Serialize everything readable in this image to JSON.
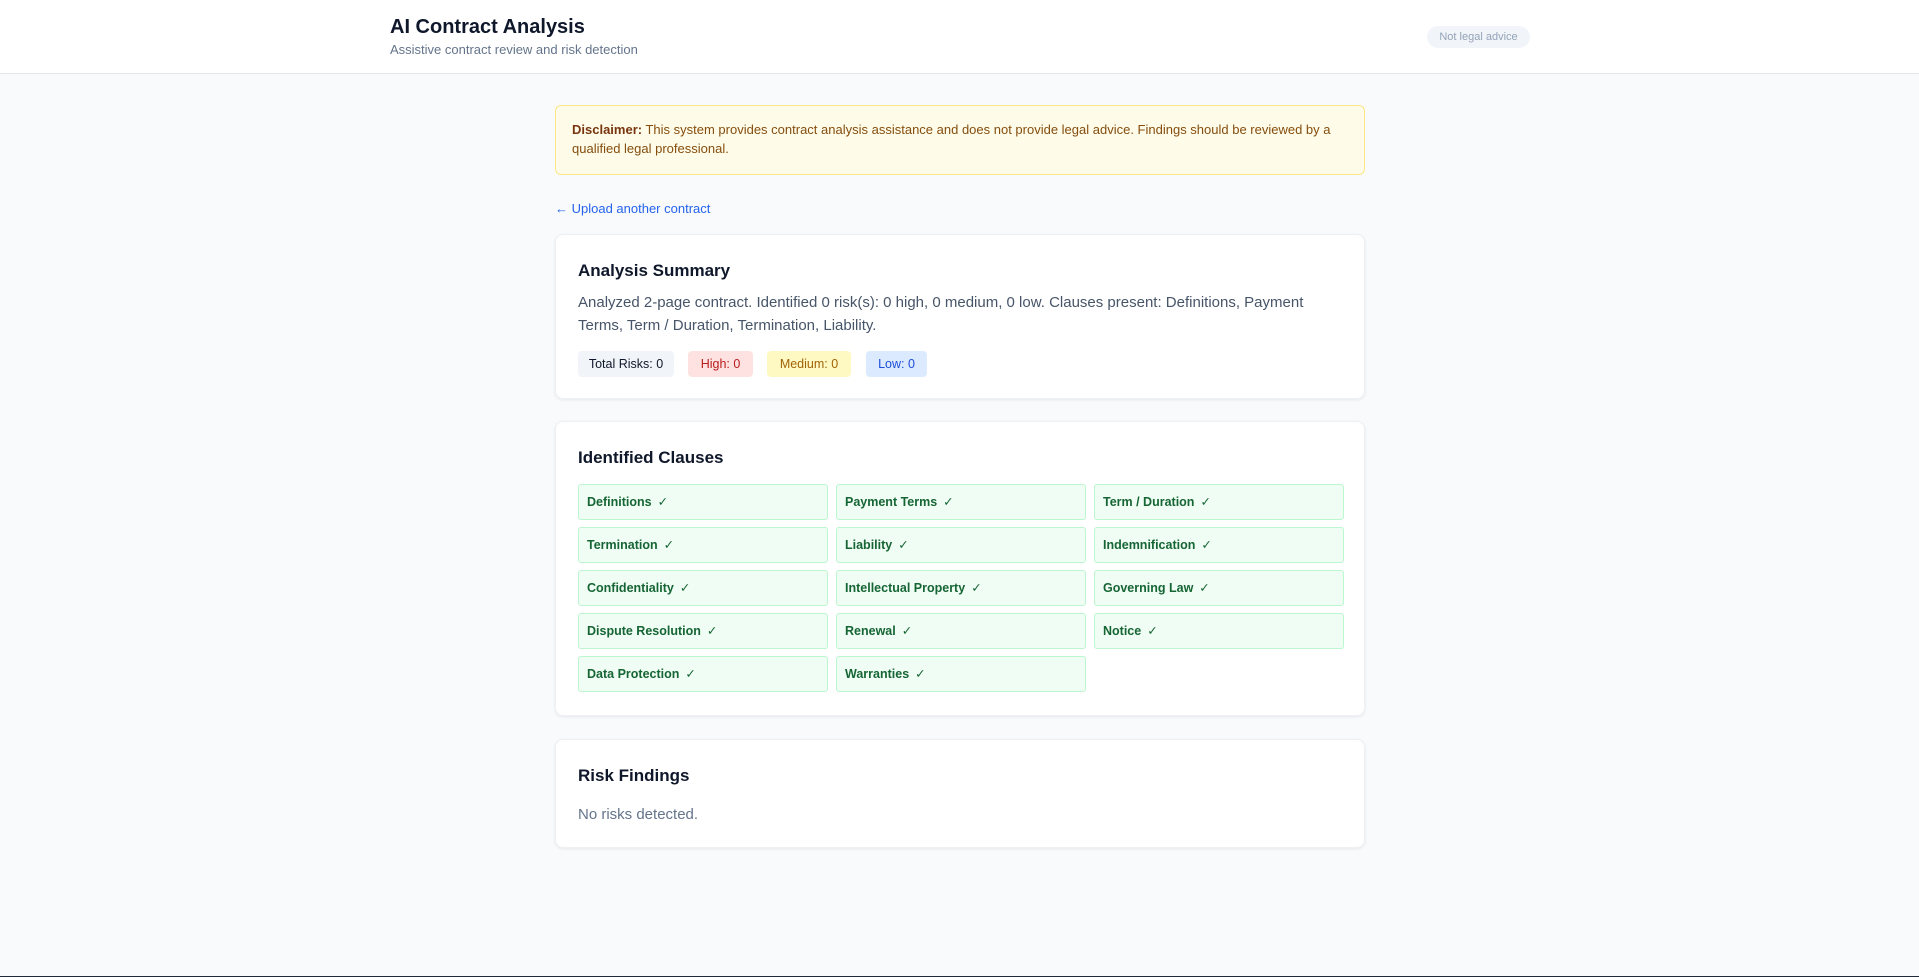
{
  "header": {
    "title": "AI Contract Analysis",
    "subtitle": "Assistive contract review and risk detection",
    "badge": "Not legal advice"
  },
  "disclaimer": {
    "label": "Disclaimer:",
    "text": " This system provides contract analysis assistance and does not provide legal advice. Findings should be reviewed by a qualified legal professional."
  },
  "back_link": "← Upload another contract",
  "summary": {
    "title": "Analysis Summary",
    "text": "Analyzed 2-page contract. Identified 0 risk(s): 0 high, 0 medium, 0 low. Clauses present: Definitions, Payment Terms, Term / Duration, Termination, Liability.",
    "total": "Total Risks: 0",
    "high": "High: 0",
    "medium": "Medium: 0",
    "low": "Low: 0"
  },
  "clauses": {
    "title": "Identified Clauses",
    "check": "✓",
    "items": [
      "Definitions",
      "Payment Terms",
      "Term / Duration",
      "Termination",
      "Liability",
      "Indemnification",
      "Confidentiality",
      "Intellectual Property",
      "Governing Law",
      "Dispute Resolution",
      "Renewal",
      "Notice",
      "Data Protection",
      "Warranties"
    ]
  },
  "risks": {
    "title": "Risk Findings",
    "empty_text": "No risks detected."
  },
  "colors": {
    "accent_link": "#2563eb",
    "clause_bg": "#f0fdf4",
    "clause_text": "#166534",
    "high": "#b91c1c",
    "medium": "#a16207",
    "low": "#1d4ed8"
  }
}
